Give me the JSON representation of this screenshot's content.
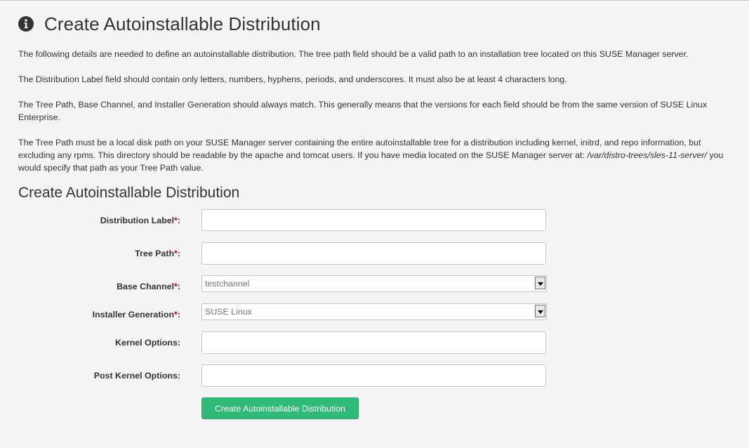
{
  "header": {
    "title": "Create Autoinstallable Distribution",
    "icon": "info-circle-icon"
  },
  "intro": {
    "p1": "The following details are needed to define an autoinstallable distribution. The tree path field should be a valid path to an installation tree located on this SUSE Manager server.",
    "p2": "The Distribution Label field should contain only letters, numbers, hyphens, periods, and underscores. It must also be at least 4 characters long.",
    "p3": "The Tree Path, Base Channel, and Installer Generation should always match. This generally means that the versions for each field should be from the same version of SUSE Linux Enterprise.",
    "p4_text": "The Tree Path must be a local disk path on your SUSE Manager server containing the entire autoinstallable tree for a distribution including kernel, initrd, and repo information, but excluding any rpms. This directory should be readable by the apache and tomcat users. If you have media located on the SUSE Manager server at:",
    "p4_path": "/var/distro-trees/sles-11-server/",
    "p4_end": "you would specify that path as your Tree Path value."
  },
  "form": {
    "title": "Create Autoinstallable Distribution",
    "required_marker": "*",
    "fields": {
      "distribution_label": {
        "label": "Distribution Label",
        "value": ""
      },
      "tree_path": {
        "label": "Tree Path",
        "value": ""
      },
      "base_channel": {
        "label": "Base Channel",
        "selected": "testchannel"
      },
      "installer_generation": {
        "label": "Installer Generation",
        "selected": "SUSE Linux"
      },
      "kernel_options": {
        "label": "Kernel Options",
        "value": ""
      },
      "post_kernel_options": {
        "label": "Post Kernel Options",
        "value": ""
      }
    },
    "submit_label": "Create Autoinstallable Distribution"
  },
  "colors": {
    "background": "#f4f4f4",
    "accent_button": "#30ba78",
    "required": "#cc0000",
    "text": "#333333"
  }
}
